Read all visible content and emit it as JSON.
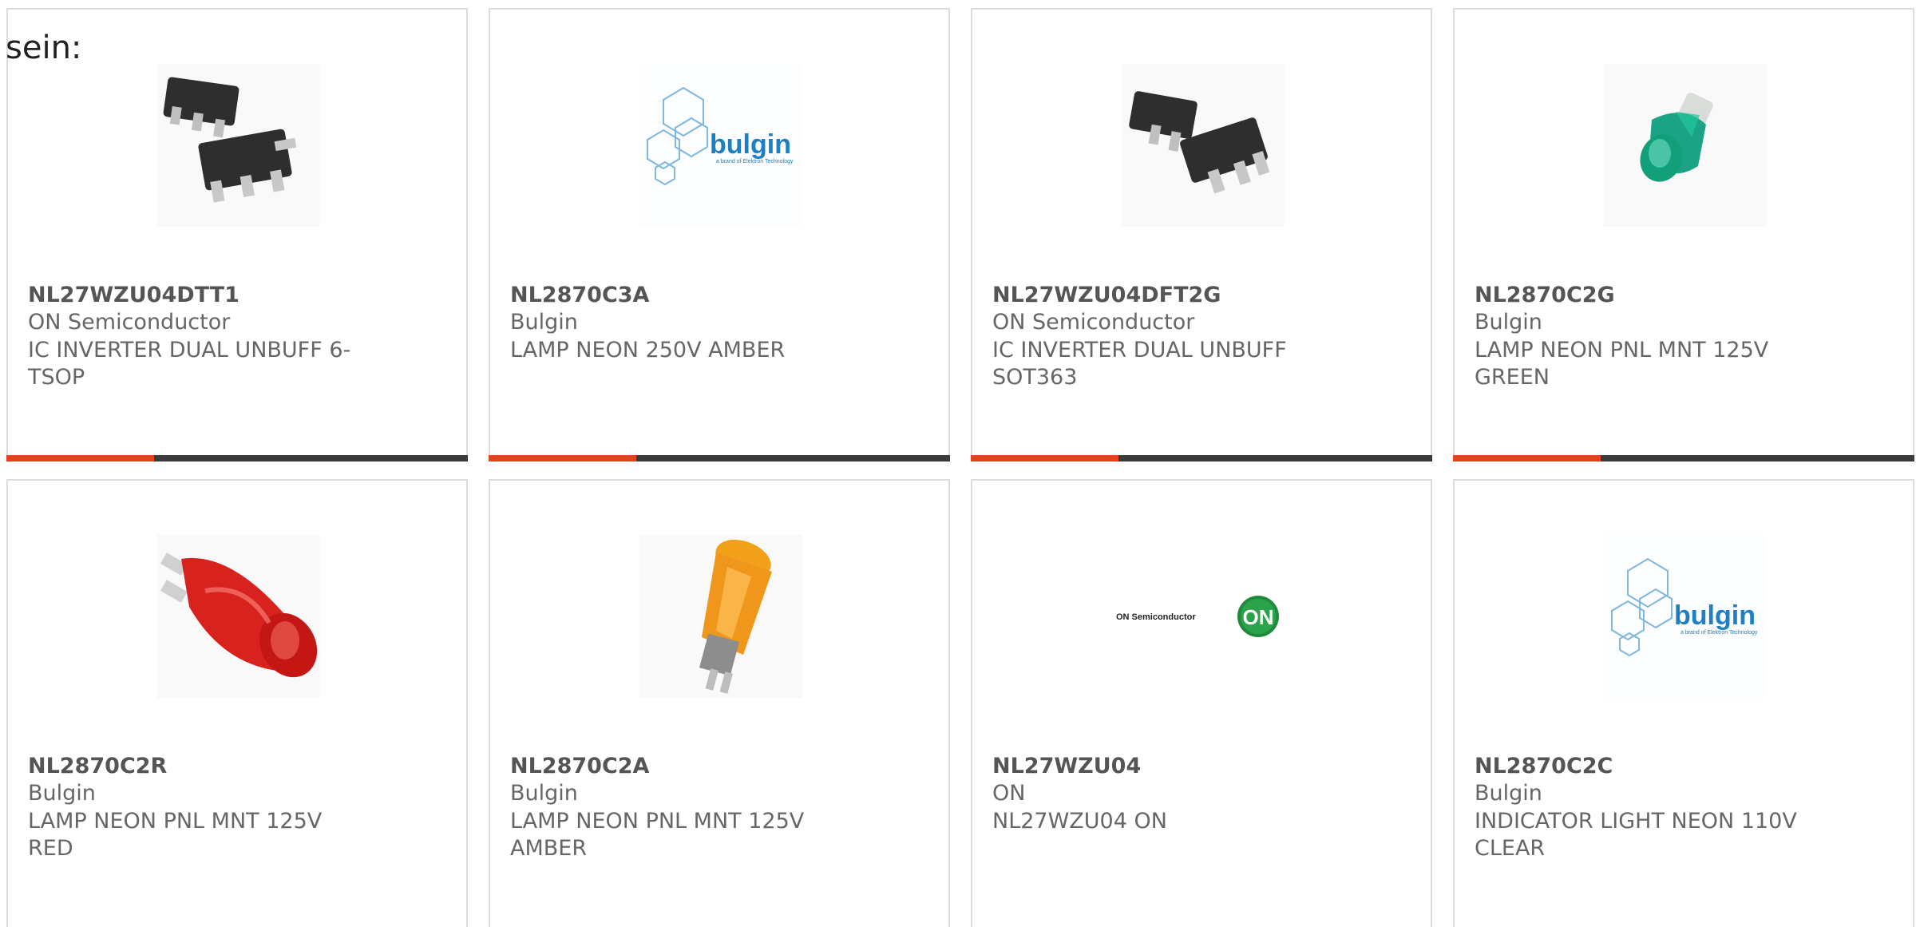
{
  "intro_text": "sein:",
  "products": [
    {
      "part": "NL27WZU04DTT1",
      "manufacturer": "ON Semiconductor",
      "description": "IC INVERTER DUAL UNBUFF 6-TSOP",
      "image": "ic-chip-image"
    },
    {
      "part": "NL2870C3A",
      "manufacturer": "Bulgin",
      "description": "LAMP NEON 250V AMBER",
      "image": "bulgin-logo-image"
    },
    {
      "part": "NL27WZU04DFT2G",
      "manufacturer": "ON Semiconductor",
      "description": "IC INVERTER DUAL UNBUFF SOT363",
      "image": "ic-chip-image"
    },
    {
      "part": "NL2870C2G",
      "manufacturer": "Bulgin",
      "description": "LAMP NEON PNL MNT 125V GREEN",
      "image": "green-neon-lamp-image"
    },
    {
      "part": "NL2870C2R",
      "manufacturer": "Bulgin",
      "description": "LAMP NEON PNL MNT 125V RED",
      "image": "red-neon-lamp-image"
    },
    {
      "part": "NL2870C2A",
      "manufacturer": "Bulgin",
      "description": "LAMP NEON PNL MNT 125V AMBER",
      "image": "amber-neon-lamp-image"
    },
    {
      "part": "NL27WZU04",
      "manufacturer": "ON",
      "description": "NL27WZU04 ON",
      "image": "on-semiconductor-logo-image"
    },
    {
      "part": "NL2870C2C",
      "manufacturer": "Bulgin",
      "description": "INDICATOR LIGHT NEON 110V CLEAR",
      "image": "bulgin-logo-image"
    }
  ],
  "logos": {
    "bulgin_name": "bulgin",
    "bulgin_tagline": "a brand of Elektron Technology",
    "on_name": "ON Semiconductor",
    "on_mark": "ON"
  },
  "colors": {
    "accent": "#e8401c",
    "bar_track": "#3b3b3b",
    "bulgin_blue": "#1e7fc3",
    "on_green": "#1f8a3a"
  },
  "bar_fill_fraction": 0.32
}
